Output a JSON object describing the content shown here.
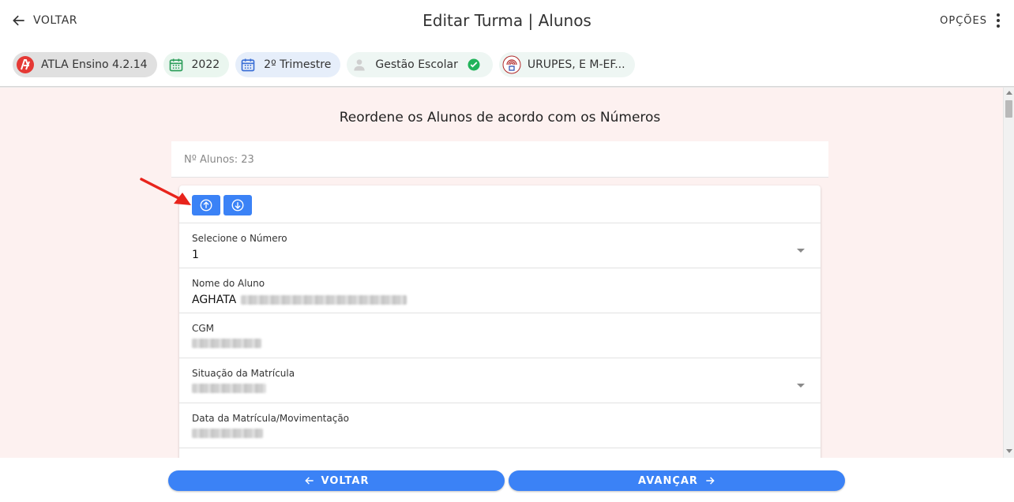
{
  "header": {
    "back_label": "VOLTAR",
    "title": "Editar Turma | Alunos",
    "options_label": "OPÇÕES"
  },
  "chips": [
    {
      "label": "ATLA Ensino 4.2.14"
    },
    {
      "label": "2022"
    },
    {
      "label": "2º Trimestre"
    },
    {
      "label": "Gestão Escolar"
    },
    {
      "label": "URUPES, E M-EF..."
    }
  ],
  "main": {
    "section_title": "Reordene os Alunos de acordo com os Números",
    "count_label": "Nº Alunos: 23",
    "fields": {
      "number_label": "Selecione o Número",
      "number_value": "1",
      "name_label": "Nome do Aluno",
      "name_value": "AGHATA",
      "cgm_label": "CGM",
      "status_label": "Situação da Matrícula",
      "date_label": "Data da Matrícula/Movimentação"
    }
  },
  "footer": {
    "back_label": "VOLTAR",
    "next_label": "AVANÇAR"
  },
  "colors": {
    "accent": "#3b82f6",
    "content_bg": "#fdf1f0",
    "annotation_arrow": "#e8241c"
  },
  "icons": {
    "back": "arrow-left-icon",
    "options": "more-vertical-icon",
    "move_up": "arrow-up-circle-icon",
    "move_down": "arrow-down-circle-icon"
  }
}
